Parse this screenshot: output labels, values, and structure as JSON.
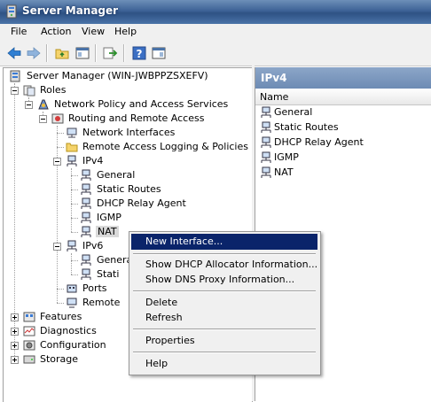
{
  "window": {
    "title": "Server Manager"
  },
  "menu": {
    "items": [
      "File",
      "Action",
      "View",
      "Help"
    ]
  },
  "toolbar": {
    "buttons": [
      "back-icon",
      "forward-icon",
      "up-folder-icon",
      "show-hide-tree-icon",
      "export-icon",
      "help-icon",
      "properties-icon"
    ]
  },
  "tree": {
    "root": "Server Manager (WIN-JWBPPZSXEFV)",
    "roles": "Roles",
    "npas": "Network Policy and Access Services",
    "rras": "Routing and Remote Access",
    "netif": "Network Interfaces",
    "ralog": "Remote Access Logging & Policies",
    "ipv4": "IPv4",
    "general": "General",
    "static": "Static Routes",
    "dhcp": "DHCP Relay Agent",
    "igmp": "IGMP",
    "nat": "NAT",
    "ipv6": "IPv6",
    "ipv6_general": "Genera",
    "ipv6_static": "Stati",
    "ports": "Ports",
    "remote": "Remote",
    "features": "Features",
    "diagnostics": "Diagnostics",
    "configuration": "Configuration",
    "storage": "Storage"
  },
  "right": {
    "header": "IPv4",
    "column": "Name",
    "rows": [
      "General",
      "Static Routes",
      "DHCP Relay Agent",
      "IGMP",
      "NAT"
    ]
  },
  "context_menu": {
    "new_interface": "New Interface...",
    "dhcp_info": "Show DHCP Allocator Information...",
    "dns_info": "Show DNS Proxy Information...",
    "delete": "Delete",
    "refresh": "Refresh",
    "properties": "Properties",
    "help": "Help"
  },
  "colors": {
    "title_bar": "#3d6296",
    "highlight": "#0a246a",
    "pane_header": "#7a96bd"
  }
}
